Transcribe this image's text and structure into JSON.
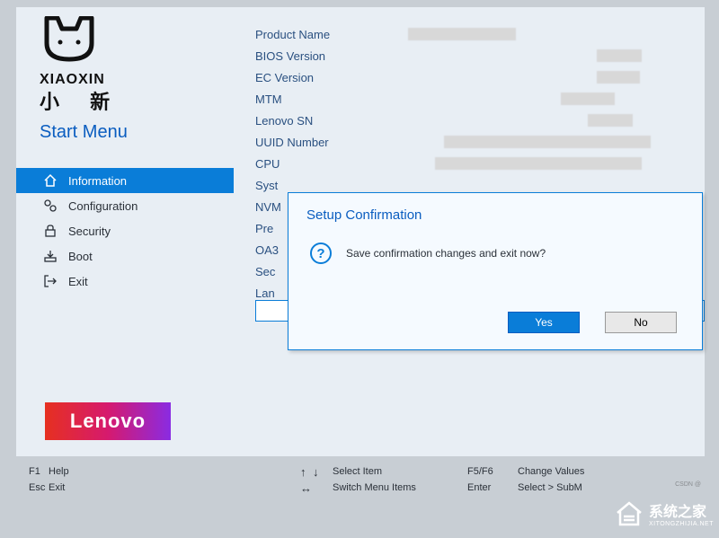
{
  "brand": {
    "name": "XIAOXIN",
    "chinese": "小 新",
    "start_menu": "Start Menu",
    "lenovo": "Lenovo"
  },
  "menu": {
    "items": [
      {
        "icon": "home-icon",
        "label": "Information",
        "active": true
      },
      {
        "icon": "config-icon",
        "label": "Configuration",
        "active": false
      },
      {
        "icon": "lock-icon",
        "label": "Security",
        "active": false
      },
      {
        "icon": "boot-icon",
        "label": "Boot",
        "active": false
      },
      {
        "icon": "exit-icon",
        "label": "Exit",
        "active": false
      }
    ]
  },
  "fields": [
    {
      "label": "Product Name"
    },
    {
      "label": "BIOS Version"
    },
    {
      "label": "EC Version"
    },
    {
      "label": "MTM"
    },
    {
      "label": "Lenovo SN"
    },
    {
      "label": "UUID Number"
    },
    {
      "label": "CPU"
    },
    {
      "label": "Syst"
    },
    {
      "label": "NVM"
    },
    {
      "label": "Pre"
    },
    {
      "label": "OA3"
    },
    {
      "label": "Sec"
    },
    {
      "label": "Lan"
    }
  ],
  "dialog": {
    "title": "Setup Confirmation",
    "message": "Save confirmation changes and exit now?",
    "yes": "Yes",
    "no": "No"
  },
  "footer": {
    "rows": [
      {
        "k1": "F1",
        "l1": "Help",
        "k2": "↑↓",
        "l2": "Select Item",
        "k3": "F5/F6",
        "l3": "Change Values"
      },
      {
        "k1": "Esc",
        "l1": "Exit",
        "k2": "↔",
        "l2": "Switch Menu Items",
        "k3": "Enter",
        "l3": "Select > SubM"
      }
    ]
  },
  "watermark": {
    "brand": "系统之家",
    "url": "XITONGZHIJIA.NET",
    "badge": "CSDN @"
  }
}
